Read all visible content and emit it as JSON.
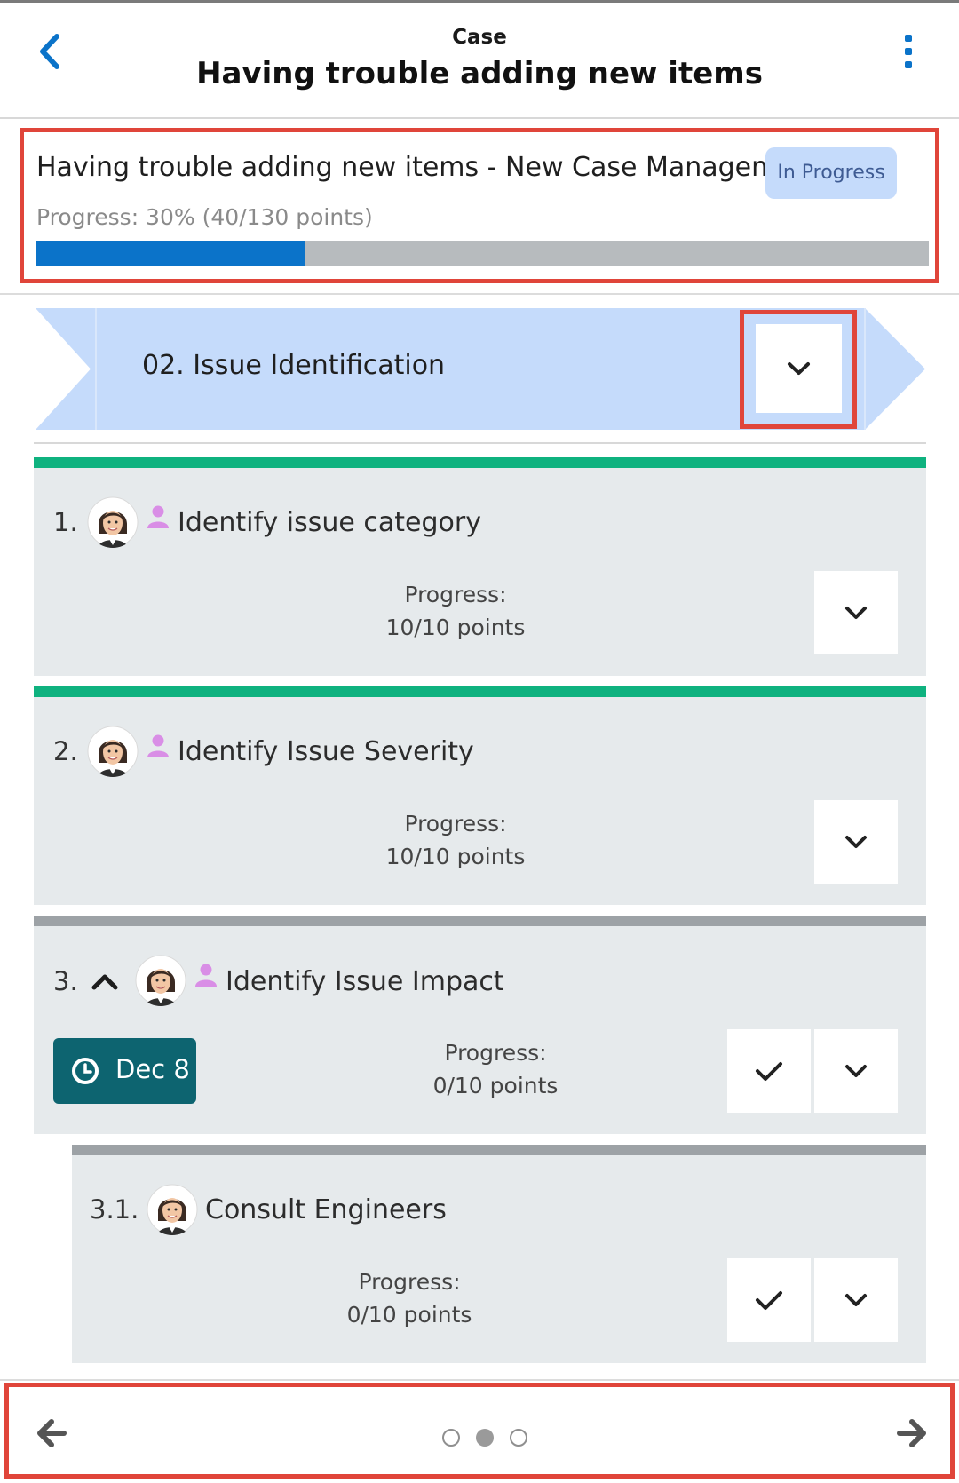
{
  "header": {
    "subtitle": "Case",
    "title": "Having trouble adding new items",
    "back_icon": "chevron-left-icon",
    "menu_icon": "vertical-ellipsis-icon"
  },
  "summary": {
    "title": "Having trouble adding new items - New Case Management",
    "status": "In Progress",
    "progress_text": "Progress: 30% (40/130 points)",
    "progress_fraction": 0.3
  },
  "stage": {
    "label": "02. Issue Identification",
    "toggle_icon": "chevron-down-icon"
  },
  "tasks": [
    {
      "number": "1.",
      "title": "Identify issue category",
      "progress_label": "Progress:",
      "progress_points": "10/10 points",
      "status_color": "#0fb27f"
    },
    {
      "number": "2.",
      "title": "Identify Issue Severity",
      "progress_label": "Progress:",
      "progress_points": "10/10 points",
      "status_color": "#0fb27f"
    },
    {
      "number": "3.",
      "title": "Identify Issue Impact",
      "progress_label": "Progress:",
      "progress_points": "0/10 points",
      "due_date": "Dec 8",
      "status_color": "#9da2a6"
    },
    {
      "number": "3.1.",
      "title": "Consult Engineers",
      "progress_label": "Progress:",
      "progress_points": "0/10 points",
      "status_color": "#9da2a6"
    }
  ],
  "footer": {
    "prev_icon": "arrow-left-icon",
    "next_icon": "arrow-right-icon",
    "page_count": 3,
    "active_page": 2
  },
  "colors": {
    "accent": "#0b73c9",
    "highlight": "#e0453a",
    "badge_bg": "#c5dbfb",
    "stage_bg": "#c5dbfb",
    "date_bg": "#0d6470"
  }
}
